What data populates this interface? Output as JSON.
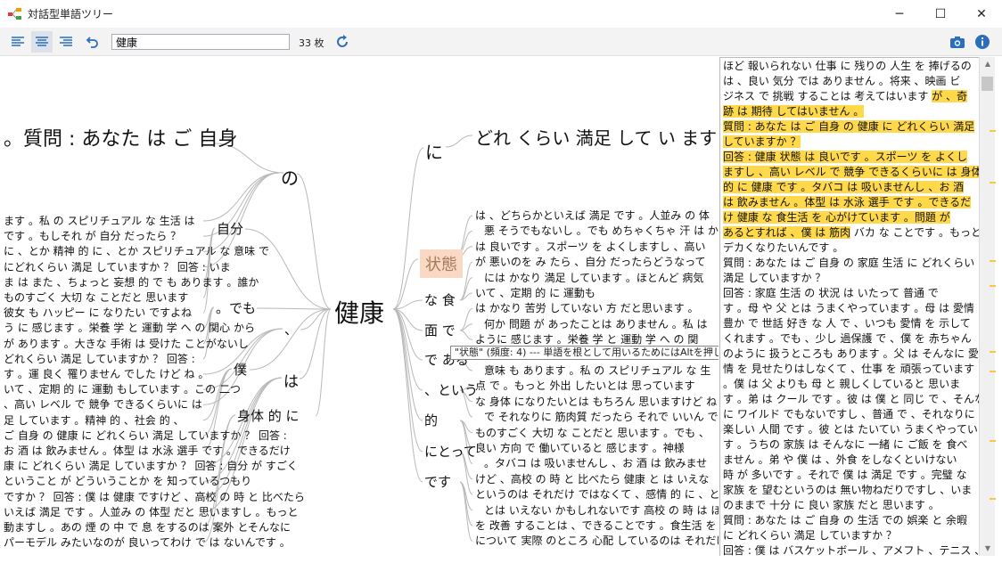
{
  "window": {
    "title": "対話型単語ツリー",
    "minimize": "─",
    "maximize": "☐",
    "close": "✕"
  },
  "toolbar": {
    "search_value": "健康",
    "count": "33 枚"
  },
  "tree": {
    "root": "健康",
    "left_heading": "。質問 : あなた は ご 自身",
    "left_branches": [
      "の",
      "自分",
      "。でも",
      "、",
      "僕",
      "は",
      "身体 的 に"
    ],
    "left_leaves": [
      "ます 。私 の スピリチュアル な 生活 は",
      "です 。もしそれ が 自分 だったら ？",
      "に 、とか 精神 的 に 、とか スピリチュアル な 意味 で",
      "にどれくらい 満足 していますか ？ 回答 : いま",
      "ま は また 、ちょっと 妄想 的 で も あります 。誰か",
      "ものすごく 大切 な ことだと 思います",
      "彼女 も ハッピー に なりたい ですよね",
      "う に 感じます 。栄養 学 と 運動 学 へ の 関心 から",
      "が あります 。大きな 手術 は 受けた ことがないし",
      "どれくらい 満足 していますか ？ 回答 :",
      "す 。運 良く 罹りません でした けど ね 。",
      "いて 、定期 的 に 運動 もしています 。この 二つ",
      "、高い レベル で 競争 できるくらいに は",
      "足 しています 。精神 的 、社会 的 、",
      "ご 自身 の 健康 に どれくらい 満足 していますか ？ 回答 :",
      "お 酒 は 飲みません 。体型 は 水泳 選手 です 。できるだけ",
      "康 に どれくらい 満足 していますか ？ 回答 : 自分 が すごく",
      "ということ が どういうことか を 知っているつもり",
      "ですか ？ 回答 : 僕 は 健康 ですけど 、高校 の 時 と 比べたら",
      "いえば 満足 です 。人並み の 体型 だと 思いますし 。もっと",
      "動ますし 。あの 煙 の 中 で 息 をするのは 案外 とそんなに",
      "パーモデル みたいなのが 良いってわけ で は ないんです 。"
    ],
    "right_heading": "どれ くらい 満足 して い ます",
    "right_branches": [
      "に",
      "状態",
      "な 食",
      "面 で",
      "で ある",
      "、という",
      "的",
      "にとって",
      "です"
    ],
    "right_leaves": [
      "は 、どちらかといえば 満足 です 。人並み の 体",
      "悪 そうでもないし 。でも めちゃくちゃ 汗 は かきま",
      "は 良いです 。スポーツ を よくしますし 、高い",
      "が 悪いのを み たら 、自分 だったらどうなって",
      "には かなり 満足 しています 。ほとんど 病気",
      "いて 、定期 的 に 運動も",
      "は かなり 苦労 していない 方 だと思います 。",
      "何か 問題 が あったことは ありません 。私 は",
      "ように 感じます 。栄養 学 と 運動 学 へ の 関",
      "ということ が どういうことか を 知っているつもり",
      "意味 も あります 。私 の スピリチュアル な 生",
      "点 で 。もっと 外出 したいとは 思っています",
      "な 身体 になりたいとは もちろん 思いますけど ね",
      "で それなりに 筋肉質 だったら それで いいん で す",
      "ものすごく 大切 な ことだと 思います 。でも 、",
      "良い 方向 で 働いていると 感じます 。神様",
      "。タバコ は 吸いませんし 、お 酒 は 飲みませ",
      "けど 、高校 の 時 と 比べたら 健康 と は いえな",
      "というのは それだけ ではなくて 、感情 的 に 、とか 精神",
      "とは いえない かもしれないです 高校 の 時 は ほとんど 毎日",
      "を 改善 することは 、できることです 。食生活 を 見直して",
      "について 実際 のところ 心配 しているのは それだけです 。"
    ],
    "tooltip": "\"状態\" (頻度: 4) --- 単語を根として用いるためにはAltを押しながらクリックしてください"
  },
  "right_panel": {
    "lines": [
      {
        "text": "ほど 報いられない 仕事 に 残りの 人生 を 捧げるの",
        "hl": false
      },
      {
        "text": "は 、良い 気分 では ありません 。将来 、映画 ビ",
        "hl": false
      },
      {
        "text": "ジネス で 挑戦 することは 考えてはいます が 、奇",
        "hl": "partial",
        "plain": "ジネス で 挑戦 することは 考えてはいます ",
        "mark": "が 、奇"
      },
      {
        "text": "跡 は 期待 してはいません 。",
        "hl": true
      },
      {
        "text": " 質問 : あなた は ご 自身 の 健康 に どれくらい 満足",
        "hl": true
      },
      {
        "text": "していますか ？",
        "hl": true
      },
      {
        "text": " 回答 : 健康 状態 は 良いです 。スポーツ を よくし",
        "hl": true
      },
      {
        "text": "ますし 、高い レベル で 競争 できるくらいに は 身体",
        "hl": true
      },
      {
        "text": "的 に 健康 です 。タバコ は 吸いませんし 、お 酒",
        "hl": true
      },
      {
        "text": "は 飲みません 。体型 は 水泳 選手 です 。できるだ",
        "hl": true
      },
      {
        "text": "け 健康 な 食生活 を 心がけています 。問題 が",
        "hl": true
      },
      {
        "text": "あるとすれば 、僕 は 筋肉 バカ な ことです 。もっと",
        "hl": "partial",
        "plain": "",
        "mark": "あるとすれば 、僕 は 筋肉",
        "rest": " バカ な ことです 。もっと"
      },
      {
        "text": "デカくなりたいんです 。",
        "hl": false
      },
      {
        "text": " 質問 : あなた は ご 自身 の 家庭 生活 に どれくらい",
        "hl": false
      },
      {
        "text": "満足 していますか ？",
        "hl": false
      },
      {
        "text": " 回答 : 家庭 生活 の 状況 は いたって 普通 で",
        "hl": false
      },
      {
        "text": "す 。母 や 父 とは うまくやっています 。母 は 愛情",
        "hl": false
      },
      {
        "text": "豊か で 世話 好き な 人 で 、いつも 愛情 を 示して",
        "hl": false
      },
      {
        "text": "くれます 。でも 、少し 過保護 で 、僕 を 赤ちゃん",
        "hl": false
      },
      {
        "text": "のように 扱うところも あります 。父 は そんなに 愛",
        "hl": false
      },
      {
        "text": "情 を 見せたりはしなくて 、仕事 を 頑張っています",
        "hl": false
      },
      {
        "text": "。僕 は 父 よりも 母 と 親しくしていると 思いま",
        "hl": false
      },
      {
        "text": "す 。弟 は クール です 。彼 は 僕 と 同じ で 、そんな",
        "hl": false
      },
      {
        "text": "に ワイルド でもないですし 、普通 で 、それなりに",
        "hl": false
      },
      {
        "text": "楽しい 人間 です 。彼 とは たいてい うまくやっていま",
        "hl": false
      },
      {
        "text": "す 。うちの 家族 は そんなに 一緒 に ご飯 を 食べ",
        "hl": false
      },
      {
        "text": "ません 。弟 や 僕 は 、外食 をしなくといけない",
        "hl": false
      },
      {
        "text": "時 が 多いです 。それで 僕 は 満足 です 。完璧 な",
        "hl": false
      },
      {
        "text": "家族 を 望むというのは 無い物ねだりですし 、いま",
        "hl": false
      },
      {
        "text": "のままで 十分 に 良い 家族 だと 思います 。",
        "hl": false
      },
      {
        "text": " 質問 : あなた は ご 自身 の 生活 での 娯楽 と 余暇",
        "hl": false
      },
      {
        "text": "に どれくらい 満足 していますか ？",
        "hl": false
      },
      {
        "text": " 回答 : 僕 は バスケットボール 、アメフト 、テニス 、",
        "hl": false
      }
    ]
  }
}
